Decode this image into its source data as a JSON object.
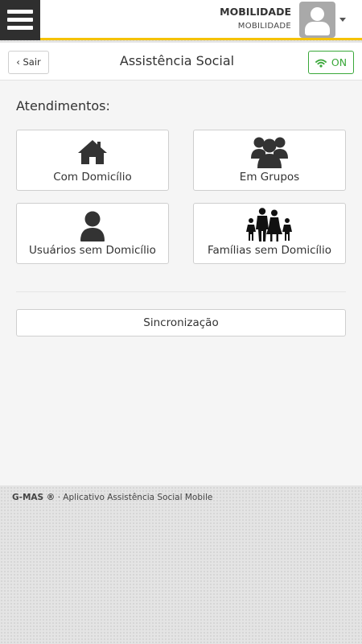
{
  "topbar": {
    "user_name": "MOBILIDADE",
    "user_sub": "MOBILIDADE"
  },
  "header": {
    "back_label": "Sair",
    "title": "Assistência Social",
    "status_label": "ON"
  },
  "main": {
    "section_title": "Atendimentos:",
    "tiles": [
      {
        "label": "Com Domicílio",
        "icon": "house-icon"
      },
      {
        "label": "Em Grupos",
        "icon": "group-icon"
      },
      {
        "label": "Usuários sem Domicílio",
        "icon": "user-icon"
      },
      {
        "label": "Famílias sem Domicílio",
        "icon": "family-icon"
      }
    ],
    "sync_label": "Sincronização"
  },
  "footer": {
    "brand": "G-MAS ®",
    "text": "· Aplicativo Assistência Social Mobile"
  },
  "colors": {
    "accent": "#f5c200",
    "online": "#3aa83a",
    "menu_bg": "#2f2f2f"
  }
}
